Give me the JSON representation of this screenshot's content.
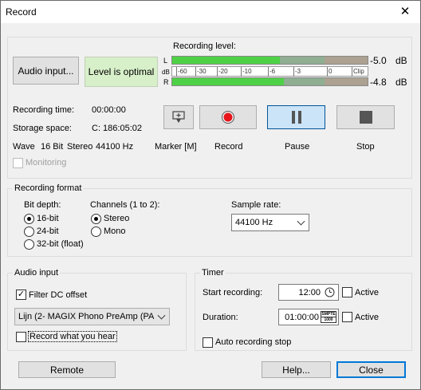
{
  "window": {
    "title": "Record",
    "close_glyph": "✕"
  },
  "recording_group": {
    "audio_input_button": "Audio input...",
    "level_status": "Level is optimal",
    "recording_level_label": "Recording level:",
    "meter": {
      "left_label": "L",
      "right_label": "R",
      "db_label": "dB",
      "left_value": "-5.0",
      "right_value": "-4.8",
      "unit": "dB",
      "left_level_fraction": 0.55,
      "right_level_fraction": 0.57,
      "scale_ticks": [
        "-60",
        "-30",
        "-20",
        "-10",
        "-6",
        "-3",
        "0",
        "Clip"
      ]
    },
    "recording_time_label": "Recording time:",
    "recording_time_value": "00:00:00",
    "storage_space_label": "Storage space:",
    "storage_space_value": "C: 186:05:02",
    "format_wave": "Wave",
    "format_bits": "16 Bit",
    "format_channels": "Stereo",
    "format_rate": "44100 Hz",
    "monitoring_label": "Monitoring",
    "transport": {
      "marker_label": "Marker [M]",
      "record_label": "Record",
      "pause_label": "Pause",
      "stop_label": "Stop"
    }
  },
  "recording_format": {
    "group_title": "Recording format",
    "bit_depth_label": "Bit depth:",
    "bit_depth_options": [
      "16-bit",
      "24-bit",
      "32-bit (float)"
    ],
    "bit_depth_selected": "16-bit",
    "channels_label": "Channels (1 to 2):",
    "channel_options": [
      "Stereo",
      "Mono"
    ],
    "channel_selected": "Stereo",
    "sample_rate_label": "Sample rate:",
    "sample_rate_value": "44100 Hz"
  },
  "audio_input": {
    "group_title": "Audio input",
    "filter_dc_label": "Filter DC offset",
    "filter_dc_checked": true,
    "device_value": "Lijn (2- MAGIX Phono PreAmp (PA",
    "record_what_you_hear_label": "Record what you hear",
    "record_what_you_hear_checked": false
  },
  "timer": {
    "group_title": "Timer",
    "start_label": "Start recording:",
    "start_value": "12:00",
    "duration_label": "Duration:",
    "duration_value": "01:00:00",
    "smpte_top": "SMPTE",
    "smpte_bottom": "1000",
    "active_label": "Active",
    "auto_stop_label": "Auto recording stop"
  },
  "footer": {
    "remote_label": "Remote",
    "help_label": "Help...",
    "close_label": "Close"
  },
  "colors": {
    "meter_green": "#4ed146",
    "meter_green_dim": "#8fae92",
    "meter_tan": "#ada191",
    "accent_blue": "#0078d7",
    "record_red": "#e8151b"
  }
}
